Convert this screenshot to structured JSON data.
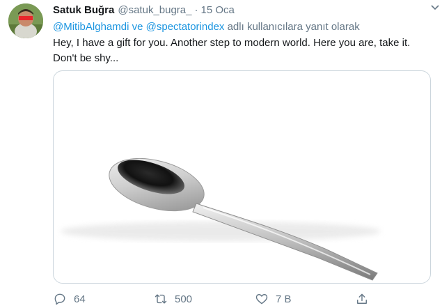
{
  "tweet": {
    "display_name": "Satuk Buğra",
    "handle": "@satuk_bugra_",
    "separator": "·",
    "date": "15 Oca",
    "reply_mention_1": "@MitibAlghamdi",
    "reply_conj": "ve",
    "reply_mention_2": "@spectatorindex",
    "reply_suffix": "adlı kullanıcılara yanıt olarak",
    "text_line1": "Hey, I have a gift for you. Another step to modern world. Here you are, take it.",
    "text_line2": "Don't be shy...",
    "counts": {
      "replies": "64",
      "retweets": "500",
      "likes": "7 B"
    }
  },
  "icons": {
    "menu": "chevron-down-icon",
    "reply": "comment-icon",
    "retweet": "retweet-icon",
    "like": "heart-icon",
    "share": "share-icon"
  },
  "colors": {
    "link": "#1b95e0",
    "muted": "#657786",
    "border": "#ccd6dd"
  }
}
